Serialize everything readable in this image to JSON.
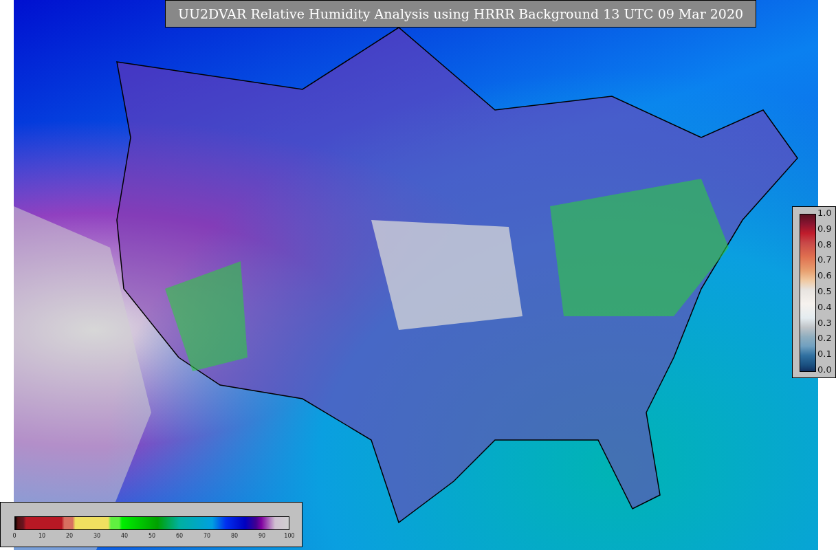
{
  "title": "UU2DVAR Relative Humidity Analysis using HRRR Background 13 UTC 09 Mar 2020",
  "humidity_colorbar": {
    "ticks": [
      "0",
      "10",
      "20",
      "30",
      "40",
      "50",
      "60",
      "70",
      "80",
      "90",
      "100"
    ]
  },
  "observation_colorbar": {
    "ticks": [
      "1.0",
      "0.9",
      "0.8",
      "0.7",
      "0.6",
      "0.5",
      "0.4",
      "0.3",
      "0.2",
      "0.1",
      "0.0"
    ]
  }
}
